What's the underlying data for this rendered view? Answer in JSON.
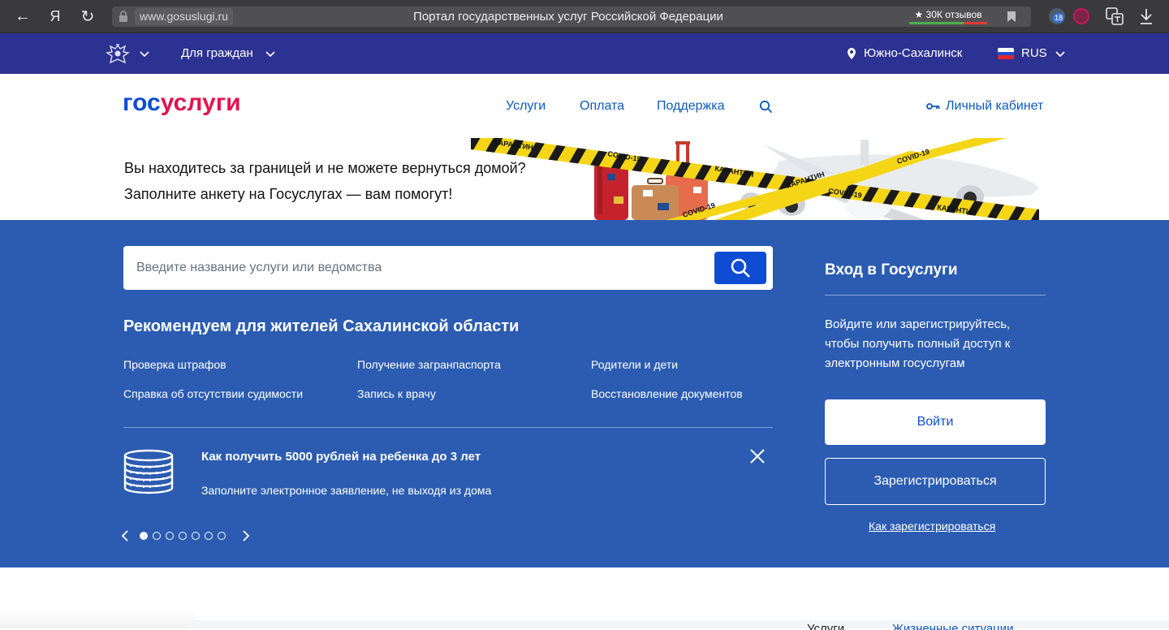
{
  "browser": {
    "url": "www.gosuslugi.ru",
    "tab_title": "Портал государственных услуг Российской Федерации",
    "reviews": "★ 30К отзывов",
    "back_glyph": "←",
    "yandex_glyph": "Я",
    "reload_glyph": "↻",
    "extension_badge": "18"
  },
  "top_strip": {
    "audience": "Для граждан",
    "city": "Южно-Сахалинск",
    "language": "RUS"
  },
  "header": {
    "logo_part1": "гос",
    "logo_part2": "услуги",
    "nav": [
      "Услуги",
      "Оплата",
      "Поддержка"
    ],
    "cabinet": "Личный кабинет"
  },
  "banner": {
    "line1": "Вы находитесь за границей и не можете вернуться домой?",
    "line2": "Заполните анкету на Госуслугах — вам помогут!",
    "tape_labels": [
      "КАРАНТИН",
      "COVID-19"
    ]
  },
  "search": {
    "placeholder": "Введите название услуги или ведомства"
  },
  "recommend": {
    "title": "Рекомендуем для жителей Сахалинской области",
    "links": [
      "Проверка штрафов",
      "Получение загранпаспорта",
      "Родители и дети",
      "Справка об отсутствии судимости",
      "Запись к врачу",
      "Восстановление документов"
    ]
  },
  "promo": {
    "title": "Как получить 5000 рублей на ребенка до 3 лет",
    "subtitle": "Заполните электронное заявление, не выходя из дома",
    "slides_total": 7,
    "active_slide": 1
  },
  "login": {
    "title": "Вход в Госуслуги",
    "description": "Войдите или зарегистрируйтесь, чтобы получить полный доступ к электронным госуслугам",
    "login_button": "Войти",
    "register_button": "Зарегистрироваться",
    "how_to_register": "Как зарегистрироваться"
  },
  "bottom": {
    "tab1": "Услуги",
    "tab2": "Жизненные ситуации"
  },
  "colors": {
    "top_strip": "#2c3291",
    "main_blue": "#2b5cb1",
    "accent_blue": "#0d4cd3",
    "logo_red": "#e4124f",
    "link_blue": "#0d5bbb"
  },
  "icons": [
    "back-icon",
    "reload-icon",
    "lock-icon",
    "bookmark-icon",
    "emblem-icon",
    "chevron-down-icon",
    "location-pin-icon",
    "flag-icon",
    "search-icon",
    "key-icon",
    "coins-icon",
    "close-icon",
    "arrow-left-icon",
    "arrow-right-icon"
  ]
}
